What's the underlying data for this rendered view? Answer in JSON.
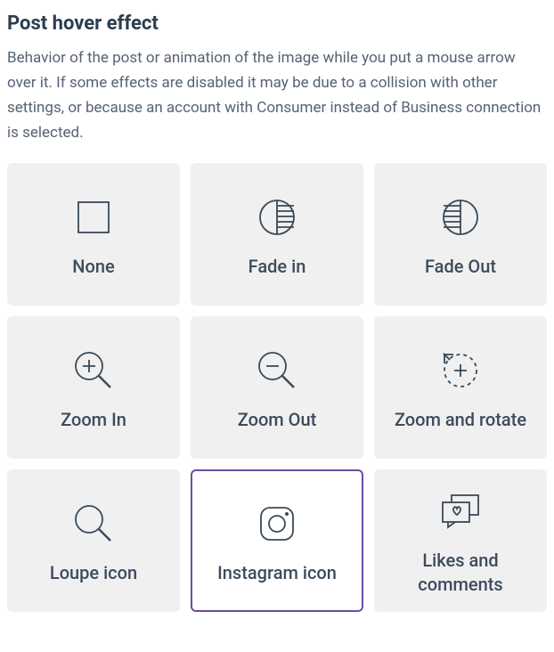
{
  "title": "Post hover effect",
  "description": "Behavior of the post or animation of the image while you put a mouse arrow over it. If some effects are disabled it may be due to a collision with other settings, or because an account with Consumer instead of Business connection is selected.",
  "options": {
    "none": "None",
    "fade_in": "Fade in",
    "fade_out": "Fade Out",
    "zoom_in": "Zoom In",
    "zoom_out": "Zoom Out",
    "zoom_rotate": "Zoom and rotate",
    "loupe": "Loupe icon",
    "instagram": "Instagram icon",
    "likes_comments": "Likes and comments"
  },
  "selected": "instagram"
}
